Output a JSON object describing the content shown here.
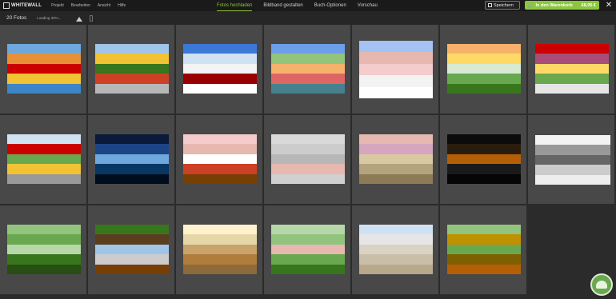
{
  "brand": {
    "logo_text": "WHITEWALL"
  },
  "menu": [
    "Projekt",
    "Bearbeiten",
    "Ansicht",
    "Hilfe"
  ],
  "tabs": [
    {
      "label": "Fotos hochladen",
      "active": true
    },
    {
      "label": "Bildband gestalten",
      "active": false
    },
    {
      "label": "Buch-Optionen",
      "active": false
    },
    {
      "label": "Vorschau",
      "active": false
    }
  ],
  "actions": {
    "save_label": "Speichern",
    "cart_label": "In den Warenkorb",
    "cart_price": "68,95 €",
    "close_glyph": "✕"
  },
  "toolbar": {
    "count_label": "20 Fotos",
    "loading_label": "Loading 30%..."
  },
  "colors": {
    "accent": "#8cc63e",
    "cell_bg": "#484848",
    "topbar_bg": "#1a1a1a"
  },
  "photos": [
    {
      "name": "colorful-houses-canal",
      "bands": [
        "#6fa8dc",
        "#e69138",
        "#cc0000",
        "#f1c232",
        "#3d85c6"
      ]
    },
    {
      "name": "colorful-houses-street",
      "bands": [
        "#9fc5e8",
        "#f1c232",
        "#38761d",
        "#cc4125",
        "#b7b7b7"
      ]
    },
    {
      "name": "winter-sled-family",
      "bands": [
        "#3c78d8",
        "#cfe2f3",
        "#f3f3f3",
        "#990000",
        "#ffffff"
      ]
    },
    {
      "name": "harbor-village",
      "bands": [
        "#6d9eeb",
        "#93c47d",
        "#f6b26b",
        "#e06666",
        "#45818e"
      ]
    },
    {
      "name": "snow-children",
      "bands": [
        "#a4c2f4",
        "#e6b8af",
        "#f4cccc",
        "#f3f3f3",
        "#ffffff"
      ]
    },
    {
      "name": "lighthouse-sunset",
      "bands": [
        "#f6b26b",
        "#ffd966",
        "#d9ead3",
        "#6aa84f",
        "#38761d"
      ]
    },
    {
      "name": "flowers-house",
      "bands": [
        "#cc0000",
        "#a64d79",
        "#ffd966",
        "#6aa84f",
        "#e6e6e6"
      ]
    },
    {
      "name": "colorful-facades",
      "bands": [
        "#cfe2f3",
        "#cc0000",
        "#6aa84f",
        "#f1c232",
        "#999999"
      ]
    },
    {
      "name": "northern-lights-night",
      "bands": [
        "#0b1a3a",
        "#1c4587",
        "#6fa8dc",
        "#073763",
        "#000d1f"
      ]
    },
    {
      "name": "child-on-bench",
      "bands": [
        "#f4cccc",
        "#e6b8af",
        "#ffffff",
        "#cc4125",
        "#783f04"
      ]
    },
    {
      "name": "kids-lying-blanket",
      "bands": [
        "#d9d9d9",
        "#cccccc",
        "#b7b7b7",
        "#e6b8af",
        "#d0d0d0"
      ]
    },
    {
      "name": "girls-wheat-field",
      "bands": [
        "#e6b8af",
        "#d5a6bd",
        "#d9c9a3",
        "#b4a37c",
        "#8d7b55"
      ]
    },
    {
      "name": "forest-night-walk",
      "bands": [
        "#0c0c0c",
        "#2b1d0e",
        "#b45f06",
        "#1a1a1a",
        "#050505"
      ]
    },
    {
      "name": "grandpa-child-bw",
      "bands": [
        "#f3f3f3",
        "#999999",
        "#666666",
        "#cccccc",
        "#eeeeee"
      ]
    },
    {
      "name": "mother-child-tree",
      "bands": [
        "#93c47d",
        "#6aa84f",
        "#b6d7a8",
        "#38761d",
        "#274e13"
      ]
    },
    {
      "name": "christmas-gifts",
      "bands": [
        "#38761d",
        "#5a3d1f",
        "#9fc5e8",
        "#cccccc",
        "#783f04"
      ]
    },
    {
      "name": "elephants-savanna",
      "bands": [
        "#fff2cc",
        "#e6d7a8",
        "#c9a36a",
        "#b07d3c",
        "#8c6a3a"
      ]
    },
    {
      "name": "family-in-field",
      "bands": [
        "#b6d7a8",
        "#93c47d",
        "#e6b8af",
        "#6aa84f",
        "#38761d"
      ]
    },
    {
      "name": "beach-walk",
      "bands": [
        "#cfe2f3",
        "#e6e6e6",
        "#d9d2c5",
        "#c9bfa9",
        "#b7a98a"
      ]
    },
    {
      "name": "park-alley-couple",
      "bands": [
        "#93c47d",
        "#bf9000",
        "#6aa84f",
        "#7f6000",
        "#b45f06"
      ]
    }
  ]
}
